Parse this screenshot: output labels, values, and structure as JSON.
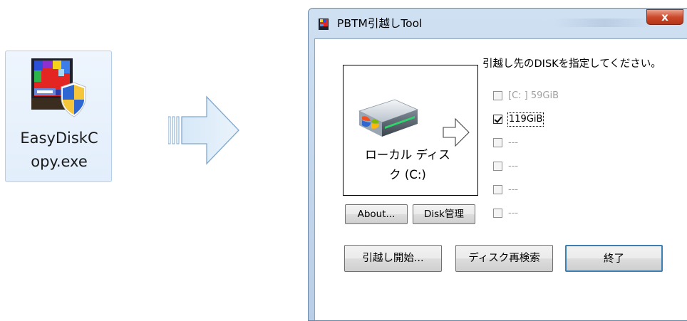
{
  "desktop_file": {
    "name": "EasyDiskC\nopy.exe",
    "icon": "easydiskcopy-shield-icon"
  },
  "arrow_icon": "right-arrow-icon",
  "dialog": {
    "title": "PBTM引越しTool",
    "close_label": "x",
    "source_drive": {
      "label": "ローカル ディス\nク (C:)",
      "icon": "hard-drive-icon"
    },
    "instruction": "引越し先のDISKを指定してください。",
    "disk_options": [
      {
        "label": "[C: ] 59GiB",
        "checked": false,
        "enabled": false
      },
      {
        "label": "119GiB",
        "checked": true,
        "enabled": true
      },
      {
        "label": "---",
        "checked": false,
        "enabled": false
      },
      {
        "label": "---",
        "checked": false,
        "enabled": false
      },
      {
        "label": "---",
        "checked": false,
        "enabled": false
      },
      {
        "label": "---",
        "checked": false,
        "enabled": false
      }
    ],
    "buttons": {
      "about": "About...",
      "disk_manage": "Disk管理",
      "start": "引越し開始...",
      "rescan": "ディスク再検索",
      "exit": "終了"
    }
  }
}
